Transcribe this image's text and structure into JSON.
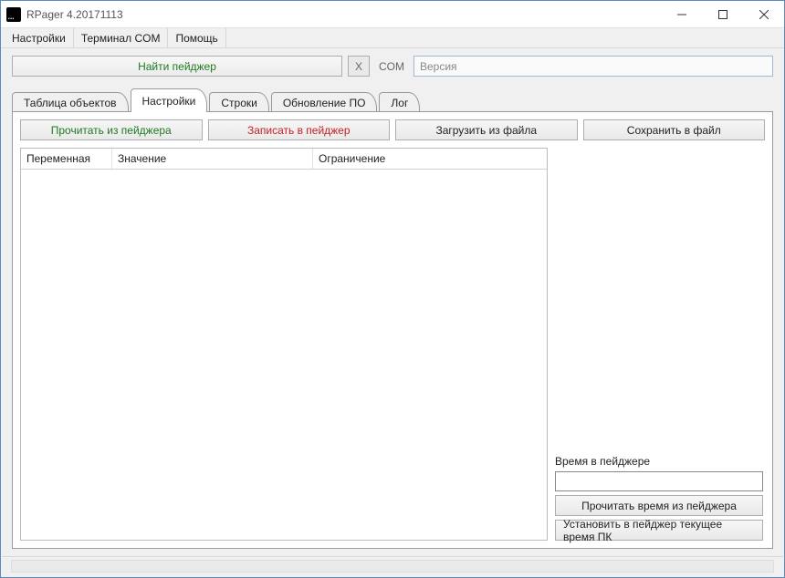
{
  "titlebar": {
    "title": "RPager  4.20171113"
  },
  "menu": {
    "settings": "Настройки",
    "terminal": "Терминал COM",
    "help": "Помощь"
  },
  "toprow": {
    "find": "Найти пейджер",
    "x": "X",
    "com_label": "COM",
    "version_placeholder": "Версия"
  },
  "tabs": {
    "t0": "Таблица объектов",
    "t1": "Настройки",
    "t2": "Строки",
    "t3": "Обновление ПО",
    "t4": "Лог"
  },
  "actions": {
    "read": "Прочитать из пейджера",
    "write": "Записать в пейджер",
    "load": "Загрузить из файла",
    "save": "Сохранить в файл"
  },
  "grid": {
    "col1": "Переменная",
    "col2": "Значение",
    "col3": "Ограничение"
  },
  "side": {
    "time_label": "Время в пейджере",
    "read_time": "Прочитать время из пейджера",
    "set_time": "Установить в пейджер текущее время ПК"
  }
}
